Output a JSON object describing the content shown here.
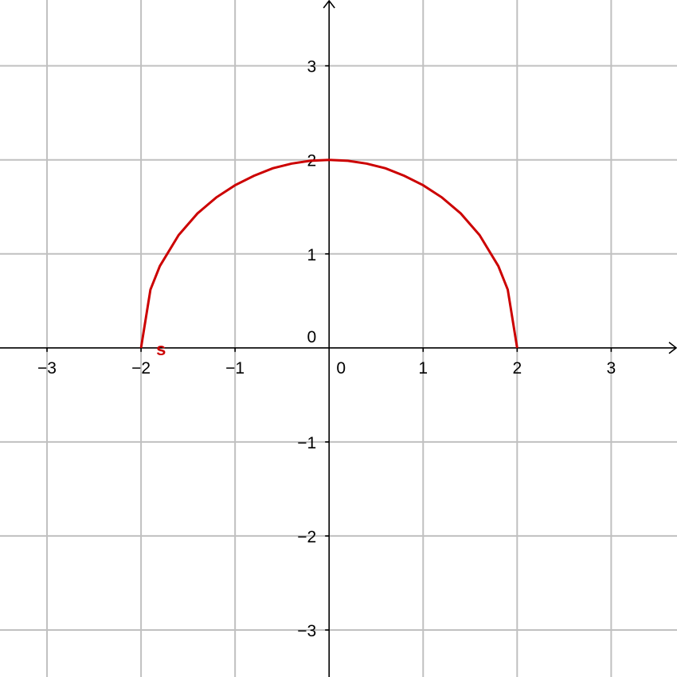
{
  "chart_data": {
    "type": "line",
    "title": "",
    "xlabel": "",
    "ylabel": "",
    "xlim": [
      -3.5,
      3.7
    ],
    "ylim": [
      -3.5,
      3.7
    ],
    "grid": true,
    "x_ticks": [
      -3,
      -2,
      -1,
      0,
      1,
      2,
      3
    ],
    "y_ticks": [
      -3,
      -2,
      -1,
      0,
      1,
      2,
      3
    ],
    "x_tick_labels": [
      "−3",
      "−2",
      "−1",
      "0",
      "1",
      "2",
      "3"
    ],
    "y_tick_labels": [
      "−3",
      "−2",
      "−1",
      "0",
      "1",
      "2",
      "3"
    ],
    "series": [
      {
        "name": "s",
        "color": "#cc0000",
        "x": [
          -2.0,
          -1.9,
          -1.8,
          -1.6,
          -1.4,
          -1.2,
          -1.0,
          -0.8,
          -0.6,
          -0.4,
          -0.2,
          0.0,
          0.2,
          0.4,
          0.6,
          0.8,
          1.0,
          1.2,
          1.4,
          1.6,
          1.8,
          1.9,
          2.0
        ],
        "y": [
          0.0,
          0.62,
          0.87,
          1.2,
          1.43,
          1.6,
          1.73,
          1.83,
          1.91,
          1.96,
          1.99,
          2.0,
          1.99,
          1.96,
          1.91,
          1.83,
          1.73,
          1.6,
          1.43,
          1.2,
          0.87,
          0.62,
          0.0
        ]
      }
    ]
  }
}
